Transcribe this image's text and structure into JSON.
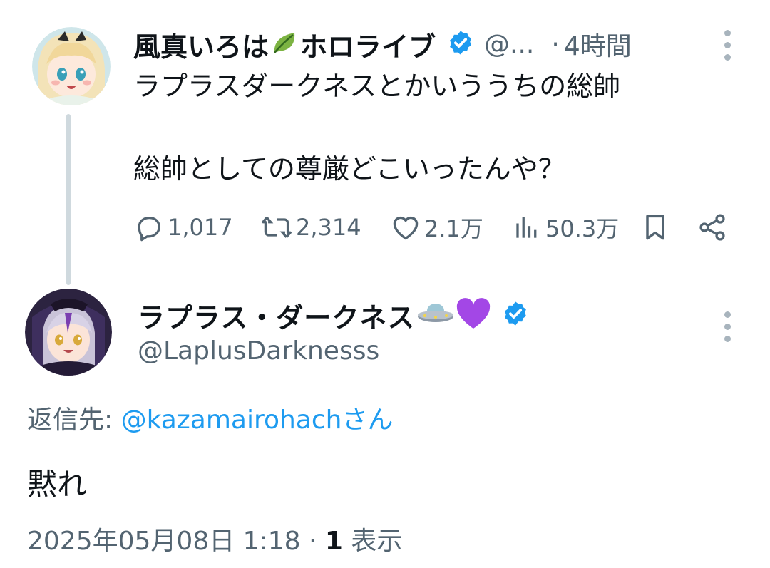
{
  "parent_tweet": {
    "display_name": "風真いろは",
    "display_name_suffix": "ホロライブ",
    "name_emoji": "leaf-icon",
    "handle_truncated": "@...",
    "separator": "·",
    "time_ago": "4時間",
    "text_line_1": "ラプラスダークネスとかいううちの総帥",
    "text_line_2": "総帥としての尊厳どこいったんや？",
    "actions": {
      "replies": "1,017",
      "reposts": "2,314",
      "likes": "2.1万",
      "views": "50.3万"
    }
  },
  "reply_tweet": {
    "display_name": "ラプラス・ダークネス",
    "name_emojis": [
      "ufo-icon",
      "purple-heart-icon"
    ],
    "handle": "@LaplusDarknesss",
    "reply_to_label": "返信先:",
    "reply_to_mention": "@kazamairohachさん",
    "text": "黙れ",
    "timestamp": "2025年05月08日 1:18",
    "meta_separator": "·",
    "views_count": "1",
    "views_label": "表示"
  },
  "colors": {
    "verified_blue": "#1d9bf0",
    "secondary_text": "#536471",
    "mention_blue": "#1d9bf0",
    "thread_line": "#cfd9de"
  }
}
